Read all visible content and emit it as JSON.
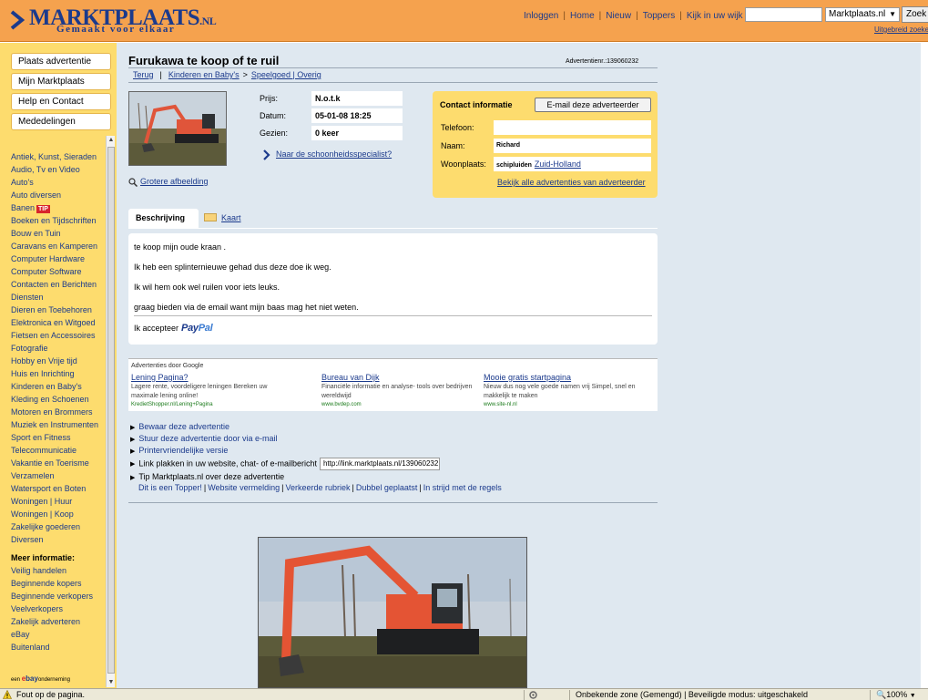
{
  "header": {
    "logo_title": "MARKTPLAATS",
    "logo_suffix": ".NL",
    "logo_tagline": "Gemaakt voor elkaar",
    "nav": [
      "Inloggen",
      "Home",
      "Nieuw",
      "Toppers",
      "Kijk in uw wijk"
    ],
    "search_value": "",
    "search_scope": "Marktplaats.nl",
    "search_button": "Zoek",
    "advanced_search": "Uitgebreid zoeken"
  },
  "sidebar": {
    "buttons": [
      "Plaats advertentie",
      "Mijn Marktplaats",
      "Help en Contact",
      "Mededelingen"
    ],
    "categories": [
      "Antiek, Kunst, Sieraden",
      "Audio, Tv en Video",
      "Auto's",
      "Auto diversen",
      "Banen",
      "Boeken en Tijdschriften",
      "Bouw en Tuin",
      "Caravans en Kamperen",
      "Computer Hardware",
      "Computer Software",
      "Contacten en Berichten",
      "Diensten",
      "Dieren en Toebehoren",
      "Elektronica en Witgoed",
      "Fietsen en Accessoires",
      "Fotografie",
      "Hobby en Vrije tijd",
      "Huis en Inrichting",
      "Kinderen en Baby's",
      "Kleding en Schoenen",
      "Motoren en Brommers",
      "Muziek en Instrumenten",
      "Sport en Fitness",
      "Telecommunicatie",
      "Vakantie en Toerisme",
      "Verzamelen",
      "Watersport en Boten",
      "Woningen | Huur",
      "Woningen | Koop",
      "Zakelijke goederen",
      "Diversen"
    ],
    "tip_badge": "TIP",
    "info_heading": "Meer informatie:",
    "info_links": [
      "Veilig handelen",
      "Beginnende kopers",
      "Beginnende verkopers",
      "Veelverkopers",
      "Zakelijk adverteren",
      "eBay",
      "Buitenland"
    ],
    "ebay_prefix": "een",
    "ebay_brand_e": "e",
    "ebay_brand_bay": "bay",
    "ebay_suffix": "onderneming"
  },
  "ad": {
    "title": "Furukawa te koop of te ruil",
    "ad_number": "Advertentienr.:139060232",
    "breadcrumb": [
      "Terug",
      "Kinderen en Baby's",
      "Speelgoed | Overig"
    ],
    "breadcrumb_arrow": ">",
    "breadcrumb_sep": "|",
    "larger_image": "Grotere afbeelding",
    "price_label": "Prijs:",
    "price": "N.o.t.k",
    "date_label": "Datum:",
    "date": "05-01-08 18:25",
    "views_label": "Gezien:",
    "views": "0 keer",
    "specialist_link": "Naar de schoonheidsspecialist?"
  },
  "contact": {
    "title": "Contact informatie",
    "email_button": "E-mail deze adverteerder",
    "phone_label": "Telefoon:",
    "phone": "",
    "name_label": "Naam:",
    "name": "Richard",
    "place_label": "Woonplaats:",
    "place": "schipluiden",
    "province": "Zuid-Holland",
    "all_ads_link": "Bekijk alle advertenties van adverteerder"
  },
  "tabs": [
    "Beschrijving",
    "Kaart"
  ],
  "description": {
    "lines": [
      "te koop mijn oude kraan .",
      "Ik heb een splinternieuwe gehad dus deze doe ik weg.",
      "Ik wil hem ook wel ruilen voor iets leuks.",
      "graag bieden via de email want mijn baas mag het niet weten."
    ],
    "accept_label": "Ik accepteer",
    "paypal_pay": "Pay",
    "paypal_pal": "Pal"
  },
  "google_ads": {
    "heading": "Advertenties door Google",
    "items": [
      {
        "title": "Lening Pagina?",
        "text": "Lagere rente, voordeligere leningen Bereken uw maximale lening online!",
        "url": "KredietShopper.nl/Lening+Pagina"
      },
      {
        "title": "Bureau van Dijk",
        "text": "Financiële informatie en analyse- tools over bedrijven wereldwijd",
        "url": "www.bvdep.com"
      },
      {
        "title": "Mooie gratis startpagina",
        "text": "Nieuw dus nog vele goede namen vrij Simpel, snel en makkelijk te maken",
        "url": "www.site-nl.nl"
      }
    ]
  },
  "actions": {
    "save": "Bewaar deze advertentie",
    "send_email": "Stuur deze advertentie door via e-mail",
    "print": "Printervriendelijke versie",
    "link_label": "Link plakken in uw website, chat- of e-mailbericht",
    "link_value": "http://link.marktplaats.nl/139060232",
    "tip_label": "Tip Marktplaats.nl over deze advertentie",
    "report_links": [
      "Dit is een Topper!",
      "Website vermelding",
      "Verkeerde rubriek",
      "Dubbel geplaatst",
      "In strijd met de regels"
    ]
  },
  "statusbar": {
    "message": "Fout op de pagina.",
    "zone": "Onbekende zone (Gemengd) | Beveiligde modus: uitgeschakeld",
    "zoom": "100%"
  },
  "colors": {
    "header_bg": "#f5a24e",
    "brand_blue": "#1b3a8c",
    "sidebar_bg": "#fddc6e",
    "main_bg": "#dfe8f0"
  }
}
